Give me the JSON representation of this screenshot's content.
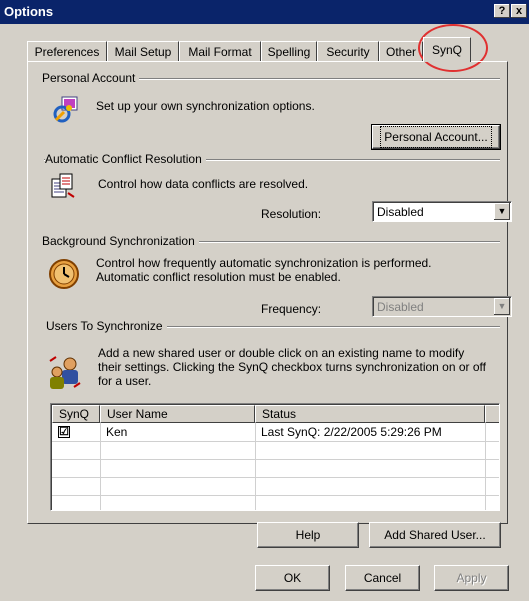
{
  "window": {
    "title": "Options",
    "help_btn": "?",
    "close_btn": "x"
  },
  "tabs": [
    {
      "label": "Preferences"
    },
    {
      "label": "Mail Setup"
    },
    {
      "label": "Mail Format"
    },
    {
      "label": "Spelling"
    },
    {
      "label": "Security"
    },
    {
      "label": "Other"
    },
    {
      "label": "SynQ",
      "active": true
    }
  ],
  "personal": {
    "title": "Personal Account",
    "desc": "Set up your own synchronization options.",
    "button": "Personal Account..."
  },
  "conflict": {
    "title": "Automatic Conflict Resolution",
    "desc": "Control how data conflicts are resolved.",
    "field_label": "Resolution:",
    "value": "Disabled"
  },
  "background": {
    "title": "Background Synchronization",
    "desc_line1": "Control how frequently automatic synchronization is performed.",
    "desc_line2": "Automatic conflict resolution must be enabled.",
    "field_label": "Frequency:",
    "value": "Disabled"
  },
  "users": {
    "title": "Users To Synchronize",
    "desc_line1": "Add a new shared user or double click on an existing name to modify",
    "desc_line2": "their settings. Clicking the SynQ checkbox turns synchronization on or off",
    "desc_line3": "for a user.",
    "columns": [
      "SynQ",
      "User Name",
      "Status"
    ],
    "rows": [
      {
        "checked": true,
        "check_glyph": "☑",
        "name": "Ken",
        "status": "Last SynQ: 2/22/2005 5:29:26 PM"
      }
    ],
    "help_button": "Help",
    "add_button": "Add Shared User..."
  },
  "footer": {
    "ok": "OK",
    "cancel": "Cancel",
    "apply": "Apply"
  },
  "colors": {
    "titlebar": "#0a246a",
    "highlight_circle": "#e03030",
    "face": "#d4d0c8"
  }
}
